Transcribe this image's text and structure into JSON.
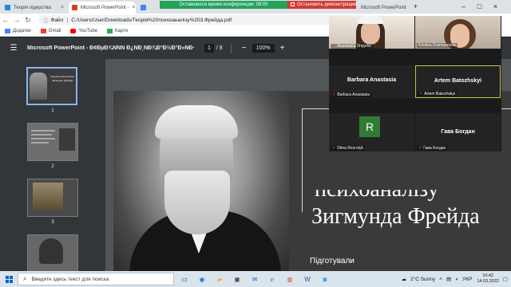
{
  "browser": {
    "tabs": [
      {
        "label": "Теорія лідерства",
        "fav": "#1e88e5"
      },
      {
        "label": "Microsoft PowerPoint - ",
        "fav": "#d84315"
      },
      {
        "label": "",
        "fav": "#4285f4"
      },
      {
        "label": "Microsoft PowerPoint",
        "fav": "#d84315"
      }
    ],
    "conference_timer": "Оставшееся время конференции: 09:00",
    "stop_share": "Остановить демонстрацию",
    "url_label": "Файл",
    "url": "C:/Users/User/Downloads/Теорія%20психоаналізу%203.Фрейда.pdf",
    "bookmarks": [
      {
        "label": "Додатки",
        "icon": "apps-icon",
        "color": "#4285f4"
      },
      {
        "label": "Gmail",
        "icon": "gmail-icon",
        "color": "#ea4335"
      },
      {
        "label": "YouTube",
        "icon": "youtube-icon",
        "color": "#ff0000"
      },
      {
        "label": "Карти",
        "icon": "maps-icon",
        "color": "#34a853"
      }
    ]
  },
  "pdf": {
    "title": "Microsoft PowerPoint - Ð¢ÐµÐ¾ÑÑÑ Ð¿ÑÐ¸ÑÐ¾Ð°Ð½Ð°Ð»ÑÐ·Ñ...",
    "page_current": "1",
    "page_total": "/ 8",
    "zoom": "100%",
    "thumb_numbers": [
      "1",
      "2",
      "3"
    ],
    "thumb1_title": "Теорія психоаналізу Зигмунда Фрейда"
  },
  "slide": {
    "title_line1": "психоаналізу",
    "title_line2": "Зигмунда Фрейда",
    "subtitle": "Підготували"
  },
  "zoom_panel": {
    "participants": [
      {
        "name": "Anastasiia Shpyrko",
        "label": "",
        "muted": true
      },
      {
        "name": "Kristina Dramaretska",
        "label": "",
        "muted": false
      },
      {
        "name": "Barbara Anastasia",
        "label": "Barbara Anastasia",
        "muted": true
      },
      {
        "name": "Artem Batozhskyi",
        "label": "Artem Batozhskyi",
        "muted": true
      },
      {
        "name": "Dima Rezrotyk",
        "label": "R",
        "muted": true
      },
      {
        "name": "Гава Богдан",
        "label": "Гава Богдан",
        "muted": true
      }
    ]
  },
  "taskbar": {
    "search_placeholder": "Введите здесь текст для поиска",
    "weather": "2°C Sunny",
    "lang": "УКР",
    "time": "10:42",
    "date": "14.03.2022"
  }
}
